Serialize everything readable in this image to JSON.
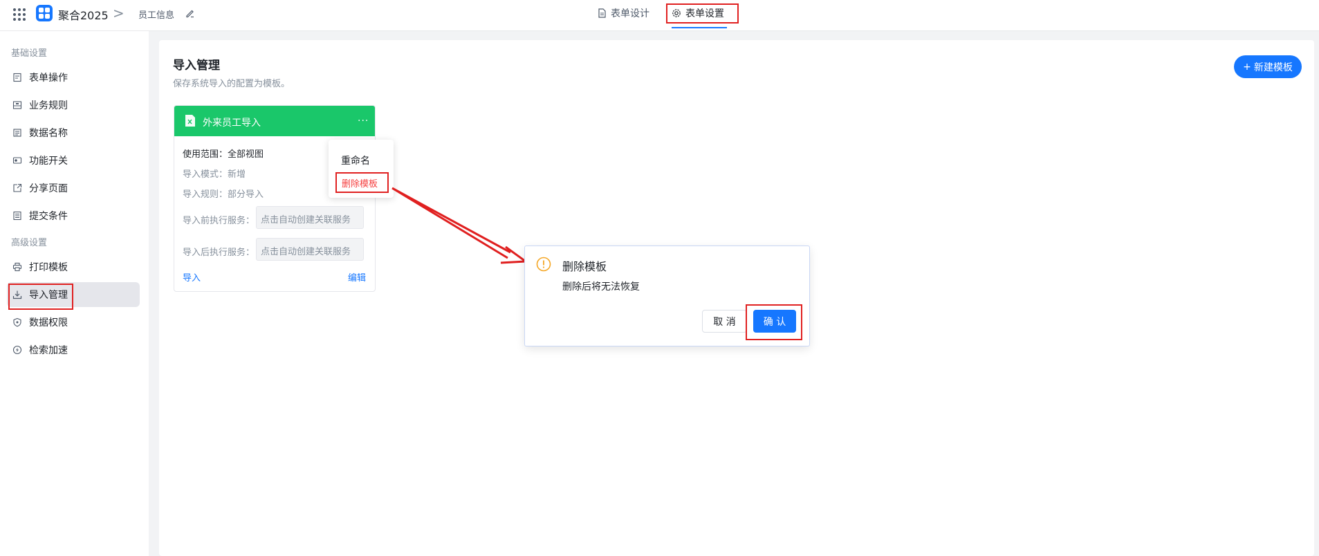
{
  "header": {
    "app_name": "聚合2025",
    "breadcrumb_sep": ">",
    "breadcrumb": "员工信息",
    "tabs": [
      {
        "label": "表单设计"
      },
      {
        "label": "表单设置"
      }
    ]
  },
  "sidebar": {
    "groups": [
      "基础设置",
      "高级设置"
    ],
    "items": [
      {
        "label": "表单操作"
      },
      {
        "label": "业务规则"
      },
      {
        "label": "数据名称"
      },
      {
        "label": "功能开关"
      },
      {
        "label": "分享页面"
      },
      {
        "label": "提交条件"
      },
      {
        "label": "打印模板"
      },
      {
        "label": "导入管理"
      },
      {
        "label": "数据权限"
      },
      {
        "label": "检索加速"
      }
    ]
  },
  "main": {
    "title": "导入管理",
    "subtitle": "保存系统导入的配置为模板。",
    "new_button": "新建模板",
    "card": {
      "title": "外来员工导入",
      "more": "···",
      "scope": "使用范围：全部视图",
      "mode": "导入模式：新增",
      "rule": "导入规则：部分导入",
      "pre_label": "导入前执行服务：",
      "pre_placeholder": "点击自动创建关联服务",
      "post_label": "导入后执行服务：",
      "post_placeholder": "点击自动创建关联服务",
      "import_link": "导入",
      "edit_link": "编辑"
    },
    "dropdown": {
      "rename": "重命名",
      "delete": "删除模板"
    }
  },
  "dialog": {
    "title": "删除模板",
    "message": "删除后将无法恢复",
    "cancel": "取 消",
    "confirm": "确 认"
  },
  "colors": {
    "accent": "#1677ff",
    "card_header": "#1ac76a",
    "danger": "#f53f3f",
    "annotation": "#e02020",
    "warning": "#f5a623"
  }
}
